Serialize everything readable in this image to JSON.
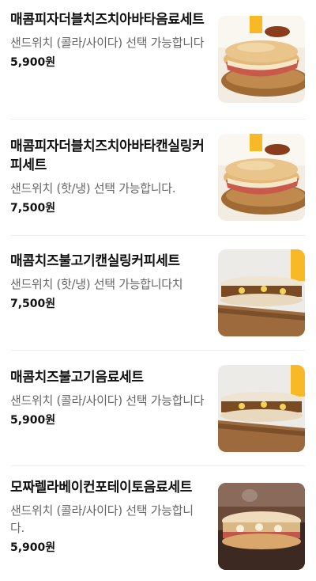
{
  "menu": {
    "items": [
      {
        "name": "매콤피자더블치즈치아바타음료세트",
        "description": "샌드위치 (콜라/사이다) 선택 가능합니다",
        "price": "5,900원",
        "photo": "ciabatta-cola-photo"
      },
      {
        "name": "매콤피자더블치즈치아바타캔실링커피세트",
        "description": "샌드위치 (핫/냉) 선택 가능합니다.",
        "price": "7,500원",
        "photo": "ciabatta-coffee-photo"
      },
      {
        "name": "매콤치즈불고기캔실링커피세트",
        "description": "샌드위치 (핫/냉) 선택 가능합니다치",
        "price": "7,500원",
        "photo": "bulgogi-coffee-photo"
      },
      {
        "name": "매콤치즈불고기음료세트",
        "description": "샌드위치 (콜라/사이다) 선택 가능합니다",
        "price": "5,900원",
        "photo": "bulgogi-cola-photo"
      },
      {
        "name": "모짜렐라베이컨포테이토음료세트",
        "description": "샌드위치 (콜라/사이다) 선택 가능합니다.",
        "price": "5,900원",
        "photo": "mozzarella-bacon-photo"
      }
    ]
  }
}
